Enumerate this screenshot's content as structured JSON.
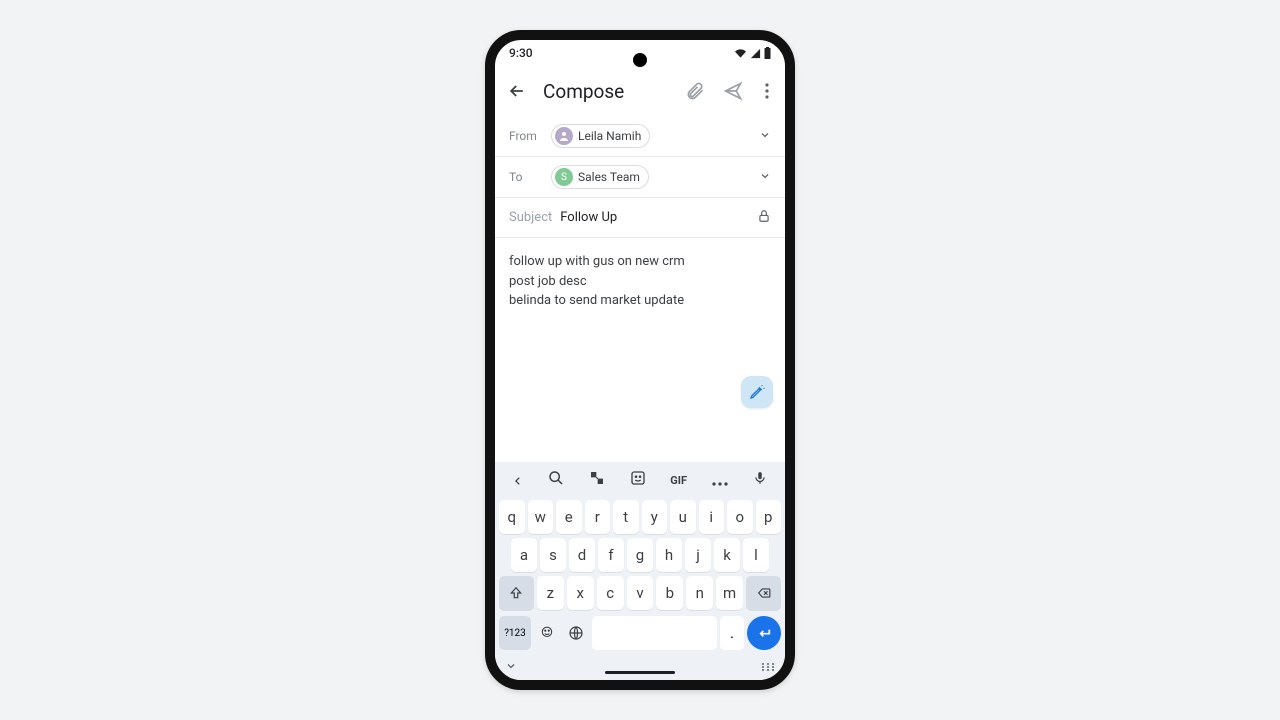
{
  "status": {
    "time": "9:30"
  },
  "app": {
    "title": "Compose"
  },
  "from": {
    "label": "From",
    "name": "Leila Namih"
  },
  "to": {
    "label": "To",
    "name": "Sales Team",
    "initial": "S"
  },
  "subject": {
    "label": "Subject",
    "text": "Follow Up"
  },
  "body": {
    "line1": "follow up with gus on new crm",
    "line2": "post job desc",
    "line3": "belinda to send market update"
  },
  "keyboard": {
    "gif": "GIF",
    "row1": [
      "q",
      "w",
      "e",
      "r",
      "t",
      "y",
      "u",
      "i",
      "o",
      "p"
    ],
    "row2": [
      "a",
      "s",
      "d",
      "f",
      "g",
      "h",
      "j",
      "k",
      "l"
    ],
    "row3": [
      "z",
      "x",
      "c",
      "v",
      "b",
      "n",
      "m"
    ],
    "numkey": "?123",
    "period": "."
  }
}
